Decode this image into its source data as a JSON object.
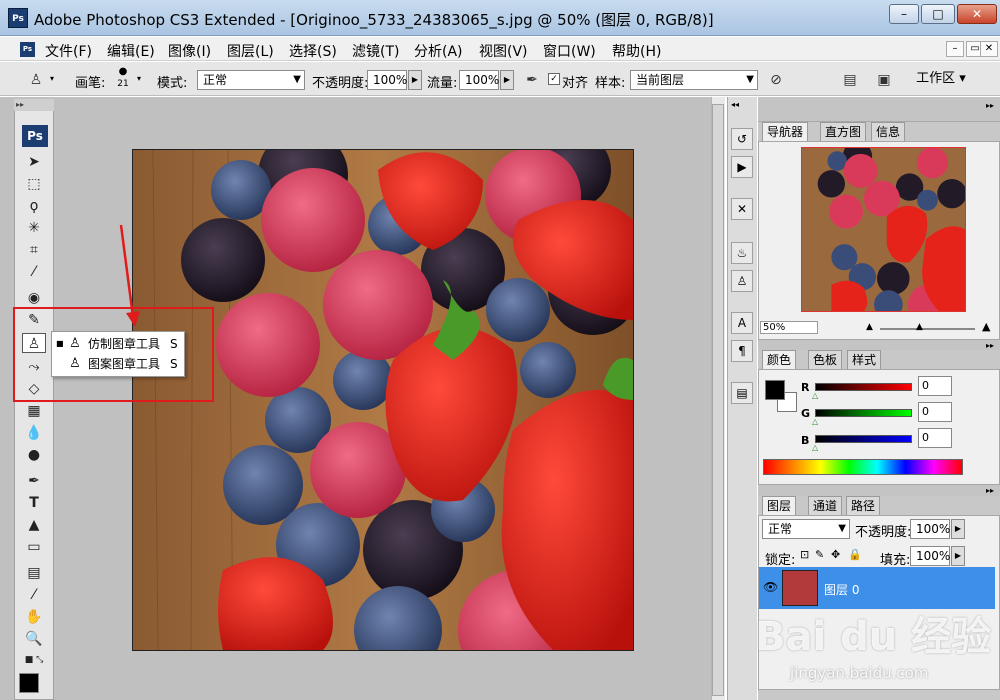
{
  "window": {
    "title": "Adobe Photoshop CS3 Extended - [Originoo_5733_24383065_s.jpg @ 50% (图层 0, RGB/8)]",
    "logo": "Ps",
    "minimize_glyph": "–",
    "maximize_glyph": "□",
    "close_glyph": "✕"
  },
  "menubar": {
    "logo": "Ps",
    "items": [
      "文件(F)",
      "编辑(E)",
      "图像(I)",
      "图层(L)",
      "选择(S)",
      "滤镜(T)",
      "分析(A)",
      "视图(V)",
      "窗口(W)",
      "帮助(H)"
    ],
    "mdi_minimize": "–",
    "mdi_restore": "▭",
    "mdi_close": "✕"
  },
  "options_bar": {
    "brush_label": "画笔:",
    "brush_size": "21",
    "mode_label": "模式:",
    "mode_value": "正常",
    "opacity_label": "不透明度:",
    "opacity_value": "100%",
    "flow_label": "流量:",
    "flow_value": "100%",
    "aligned_label": "对齐",
    "aligned_check": "✓",
    "sample_label": "样本:",
    "sample_value": "当前图层",
    "workspace_label": "工作区 ▾"
  },
  "toolbox": {
    "logo": "Ps",
    "grip": "▸▸",
    "flyout": {
      "items": [
        {
          "label": "仿制图章工具",
          "shortcut": "S",
          "bullet": "■"
        },
        {
          "label": "图案图章工具",
          "shortcut": "S",
          "bullet": ""
        }
      ]
    }
  },
  "navigator": {
    "tabs": [
      "导航器",
      "直方图",
      "信息"
    ],
    "zoom": "50%"
  },
  "color_panel": {
    "tabs": [
      "颜色",
      "色板",
      "样式"
    ],
    "channels": [
      {
        "label": "R",
        "value": "0",
        "color": "#cc0000"
      },
      {
        "label": "G",
        "value": "0",
        "color": "#00aa00"
      },
      {
        "label": "B",
        "value": "0",
        "color": "#0000cc"
      }
    ]
  },
  "layers_panel": {
    "tabs": [
      "图层",
      "通道",
      "路径"
    ],
    "blend_mode": "正常",
    "opacity_label": "不透明度:",
    "opacity_value": "100%",
    "lock_label": "锁定:",
    "fill_label": "填充:",
    "fill_value": "100%",
    "layer_name": "图层 0"
  },
  "watermark": {
    "logo": "Bai du 经验",
    "url": "jingyan.baidu.com"
  },
  "colors": {
    "selection_blue": "#3d8fe8",
    "annotation_red": "#e01b1b",
    "ps_blue": "#1b3d72"
  }
}
